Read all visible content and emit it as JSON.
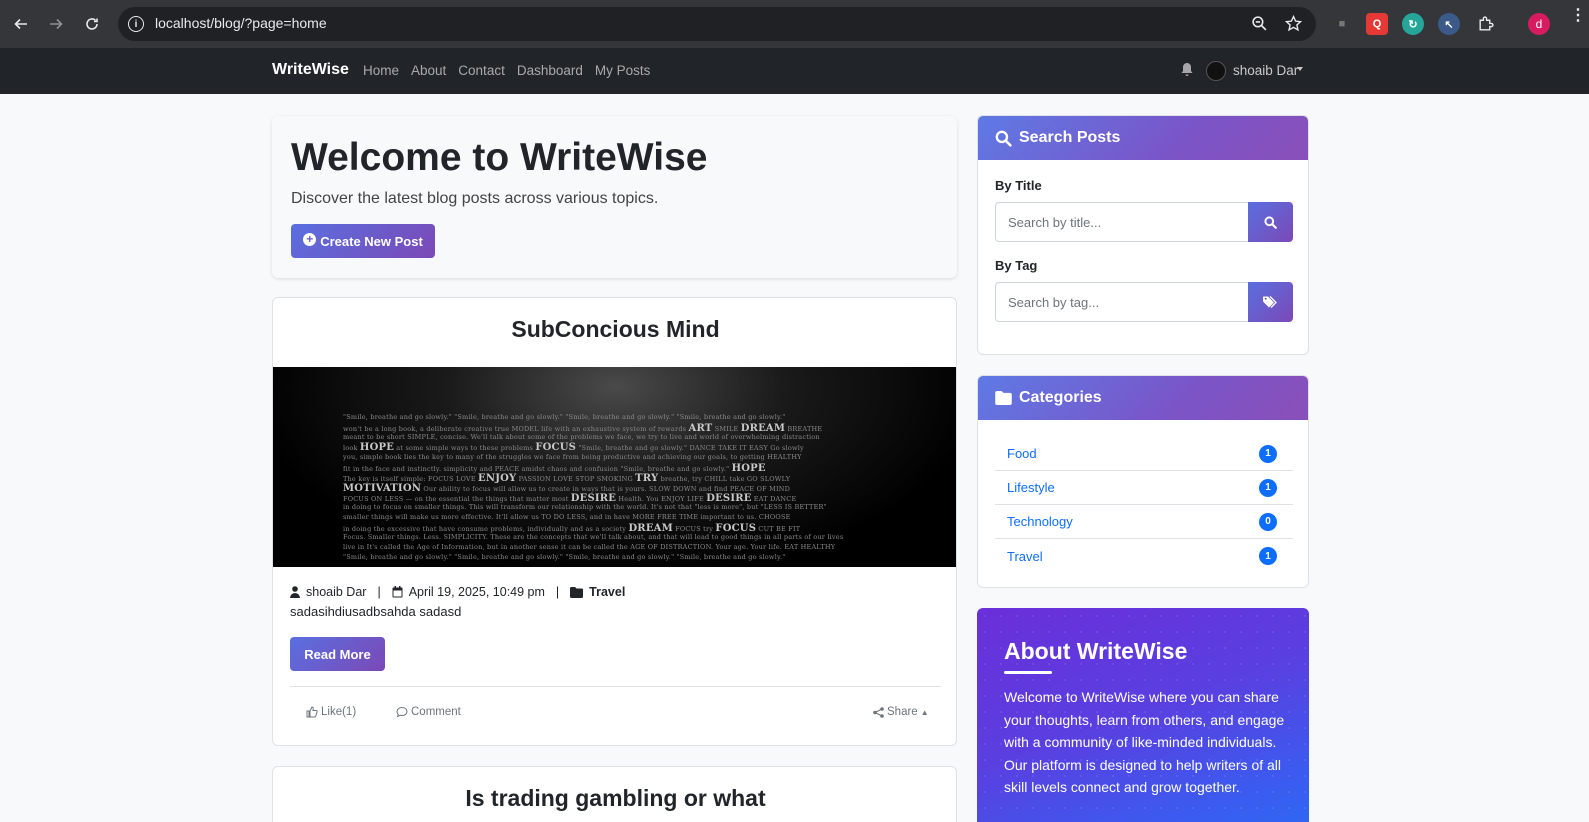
{
  "browser": {
    "url": "localhost/blog/?page=home",
    "profile_initial": "d"
  },
  "navbar": {
    "brand": "WriteWise",
    "links": [
      "Home",
      "About",
      "Contact",
      "Dashboard",
      "My Posts"
    ],
    "user_name": "shoaib Dar"
  },
  "welcome": {
    "title": "Welcome to WriteWise",
    "subtitle": "Discover the latest blog posts across various topics.",
    "create_button": "Create New Post"
  },
  "posts": [
    {
      "title": "SubConcious Mind",
      "author": "shoaib Dar",
      "date": "April 19, 2025, 10:49 pm",
      "category": "Travel",
      "excerpt": "sadasihdiusadbsahda sadasd",
      "read_more": "Read More",
      "like_label": "Like(1)",
      "comment_label": "Comment",
      "share_label": "Share"
    },
    {
      "title": "Is trading gambling or what"
    }
  ],
  "search": {
    "header": "Search Posts",
    "title_label": "By Title",
    "title_placeholder": "Search by title...",
    "tag_label": "By Tag",
    "tag_placeholder": "Search by tag..."
  },
  "categories": {
    "header": "Categories",
    "items": [
      {
        "name": "Food",
        "count": "1"
      },
      {
        "name": "Lifestyle",
        "count": "1"
      },
      {
        "name": "Technology",
        "count": "0"
      },
      {
        "name": "Travel",
        "count": "1"
      }
    ]
  },
  "about": {
    "title": "About WriteWise",
    "text": "Welcome to WriteWise where you can share your thoughts, learn from others, and engage with a community of like-minded individuals. Our platform is designed to help writers of all skill levels connect and grow together."
  }
}
